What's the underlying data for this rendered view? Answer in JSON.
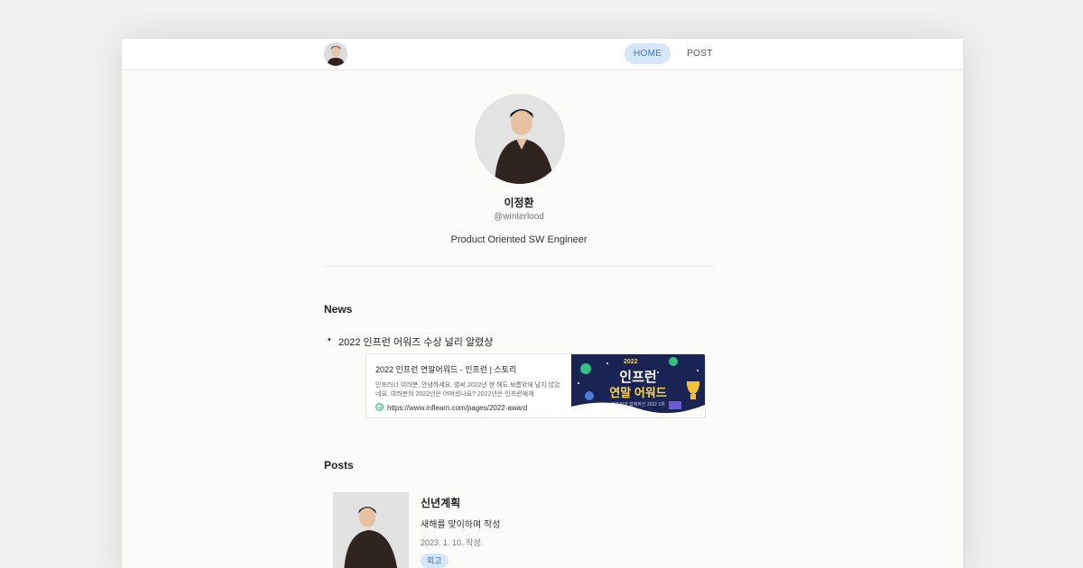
{
  "nav": {
    "items": [
      {
        "label": "HOME",
        "active": true
      },
      {
        "label": "POST",
        "active": false
      }
    ],
    "accent_color": "#d7e7fb"
  },
  "profile": {
    "name": "이정환",
    "handle": "@winterlood",
    "bio": "Product Oriented SW Engineer"
  },
  "news": {
    "heading": "News",
    "item": "2022 인프런 어워즈 수상 널리 알렸상",
    "bookmark": {
      "title": "2022 인프런 연말어워드 - 인프런 | 스토리",
      "description": "인프러너 여러분, 안녕하세요. 벌써 2022년 한 해도 보름밖에 남지 않았네요. 여러분의 2022년은 어떠셨나요? 2022년은 인프런에게",
      "url": "https://www.inflearn.com/pages/2022-award",
      "image": {
        "year": "2022",
        "line1": "인프런",
        "line2": "연말 어워드",
        "line3": "인프런과 함께하신 2022 1위"
      }
    }
  },
  "posts": {
    "heading": "Posts",
    "items": [
      {
        "title": "신년계획",
        "subtitle": "새해를 맞이하며 작성",
        "date": "2023. 1. 10. 작성",
        "tag": "회고"
      }
    ]
  }
}
